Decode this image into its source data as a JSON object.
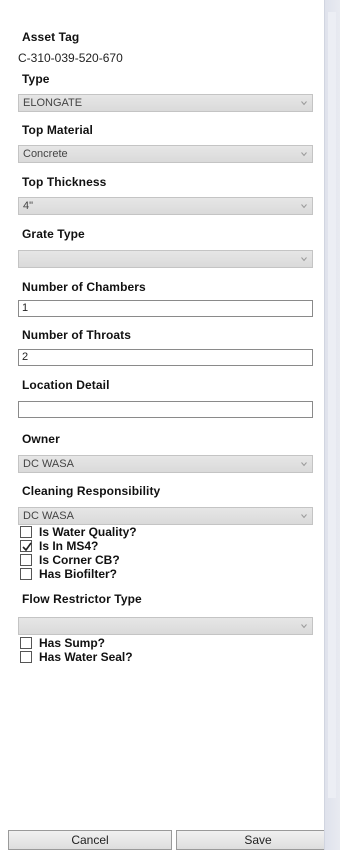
{
  "asset_tag": {
    "label": "Asset Tag",
    "value": "C-310-039-520-670"
  },
  "type": {
    "label": "Type",
    "value": "ELONGATE"
  },
  "top_material": {
    "label": "Top Material",
    "value": "Concrete"
  },
  "top_thickness": {
    "label": "Top Thickness",
    "value": "4\""
  },
  "grate_type": {
    "label": "Grate Type",
    "value": ""
  },
  "number_of_chambers": {
    "label": "Number of Chambers",
    "value": "1"
  },
  "number_of_throats": {
    "label": "Number of Throats",
    "value": "2"
  },
  "location_detail": {
    "label": "Location Detail",
    "value": ""
  },
  "owner": {
    "label": "Owner",
    "value": "DC WASA"
  },
  "cleaning_responsibility": {
    "label": "Cleaning Responsibility",
    "value": "DC WASA"
  },
  "checks": [
    {
      "label": "Is Water Quality?",
      "checked": false
    },
    {
      "label": "Is In MS4?",
      "checked": true
    },
    {
      "label": "Is Corner CB?",
      "checked": false
    },
    {
      "label": "Has Biofilter?",
      "checked": false
    }
  ],
  "flow_restrictor_type": {
    "label": "Flow Restrictor Type",
    "value": ""
  },
  "checks2": [
    {
      "label": "Has Sump?",
      "checked": false
    },
    {
      "label": "Has Water Seal?",
      "checked": false
    }
  ],
  "buttons": {
    "cancel": "Cancel",
    "save": "Save"
  }
}
